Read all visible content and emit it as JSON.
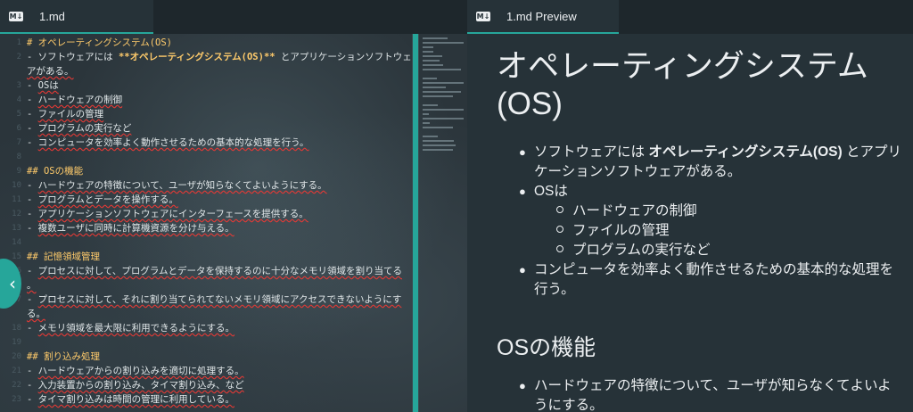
{
  "editor": {
    "tab_title": "1.md",
    "lines": [
      {
        "n": "1",
        "parts": [
          {
            "t": "# オペレーティングシステム(OS)",
            "c": "heading"
          }
        ]
      },
      {
        "n": "2",
        "parts": [
          {
            "t": "- ソフトウェアには "
          },
          {
            "t": "**オペレーティングシステム(OS)**",
            "c": "bold"
          },
          {
            "t": " とアプリケーションソフトウェ"
          }
        ]
      },
      {
        "n": "",
        "parts": [
          {
            "t": "アがある。",
            "c": "sq"
          }
        ]
      },
      {
        "n": "3",
        "parts": [
          {
            "t": "- "
          },
          {
            "t": "OSは",
            "c": "sq"
          }
        ]
      },
      {
        "n": "4",
        "parts": [
          {
            "t": "  - "
          },
          {
            "t": "ハードウェアの制御",
            "c": "sq"
          }
        ]
      },
      {
        "n": "5",
        "parts": [
          {
            "t": "  - "
          },
          {
            "t": "ファイルの管理",
            "c": "sq"
          }
        ]
      },
      {
        "n": "6",
        "parts": [
          {
            "t": "  - "
          },
          {
            "t": "プログラムの実行など",
            "c": "sq"
          }
        ]
      },
      {
        "n": "7",
        "parts": [
          {
            "t": "- "
          },
          {
            "t": "コンピュータを効率よく動作させるための基本的な処理を行う。",
            "c": "sq"
          }
        ]
      },
      {
        "n": "8",
        "parts": []
      },
      {
        "n": "9",
        "parts": [
          {
            "t": "## OSの機能",
            "c": "heading"
          }
        ]
      },
      {
        "n": "10",
        "parts": [
          {
            "t": "- "
          },
          {
            "t": "ハードウェアの特徴について、ユーザが知らなくてよいようにする。",
            "c": "sq"
          }
        ]
      },
      {
        "n": "11",
        "parts": [
          {
            "t": "- "
          },
          {
            "t": "プログラムとデータを操作する。",
            "c": "sq"
          }
        ]
      },
      {
        "n": "12",
        "parts": [
          {
            "t": "- "
          },
          {
            "t": "アプリケーションソフトウェアにインターフェースを提供する。",
            "c": "sq"
          }
        ]
      },
      {
        "n": "13",
        "parts": [
          {
            "t": "- "
          },
          {
            "t": "複数ユーザに同時に計算機資源を分け与える。",
            "c": "sq"
          }
        ]
      },
      {
        "n": "14",
        "parts": []
      },
      {
        "n": "15",
        "parts": [
          {
            "t": "## 記憶領域管理",
            "c": "heading"
          }
        ]
      },
      {
        "n": "16",
        "parts": [
          {
            "t": "- "
          },
          {
            "t": "プロセスに対して、プログラムとデータを保持するのに十分なメモリ領域を割り当てる",
            "c": "sq"
          }
        ]
      },
      {
        "n": "",
        "parts": [
          {
            "t": "。",
            "c": "sq"
          }
        ]
      },
      {
        "n": "17",
        "parts": [
          {
            "t": "- "
          },
          {
            "t": "プロセスに対して、それに割り当てられてないメモリ領域にアクセスできないようにす",
            "c": "sq"
          }
        ]
      },
      {
        "n": "",
        "parts": [
          {
            "t": "る。",
            "c": "sq"
          }
        ]
      },
      {
        "n": "18",
        "parts": [
          {
            "t": "- "
          },
          {
            "t": "メモリ領域を最大限に利用できるようにする。",
            "c": "sq"
          }
        ]
      },
      {
        "n": "19",
        "parts": []
      },
      {
        "n": "20",
        "parts": [
          {
            "t": "## 割り込み処理",
            "c": "heading"
          }
        ]
      },
      {
        "n": "21",
        "parts": [
          {
            "t": "- "
          },
          {
            "t": "ハードウェアからの割り込みを適切に処理する。",
            "c": "sq"
          }
        ]
      },
      {
        "n": "22",
        "parts": [
          {
            "t": "  - "
          },
          {
            "t": "入力装置からの割り込み、タイマ割り込み、など",
            "c": "sq"
          }
        ]
      },
      {
        "n": "23",
        "parts": [
          {
            "t": "- "
          },
          {
            "t": "タイマ割り込みは時間の管理に利用している。",
            "c": "sq"
          }
        ]
      }
    ]
  },
  "preview": {
    "tab_title": "1.md Preview",
    "h1": "オペレーティングシステム(OS)",
    "h2": "OSの機能",
    "list": {
      "item1_a": "ソフトウェアには ",
      "item1_bold": "オペレーティングシステム(OS)",
      "item1_b": " とアプリ",
      "item1_c": "ケーションソフトウェアがある。",
      "item2": "OSは",
      "sub1": "ハードウェアの制御",
      "sub2": "ファイルの管理",
      "sub3": "プログラムの実行など",
      "item3_a": "コンピュータを効率よく動作させるための基本的な処理を",
      "item3_b": "行う。",
      "item4_a": "ハードウェアの特徴について、ユーザが知らなくてよいよ",
      "item4_b": "うにする。"
    }
  },
  "icons": {
    "markdown": "markdown-icon",
    "collapse": "chevron-left-icon"
  },
  "colors": {
    "accent": "#26a69a",
    "heading": "#ffcb6b",
    "squiggle": "#e53935"
  }
}
